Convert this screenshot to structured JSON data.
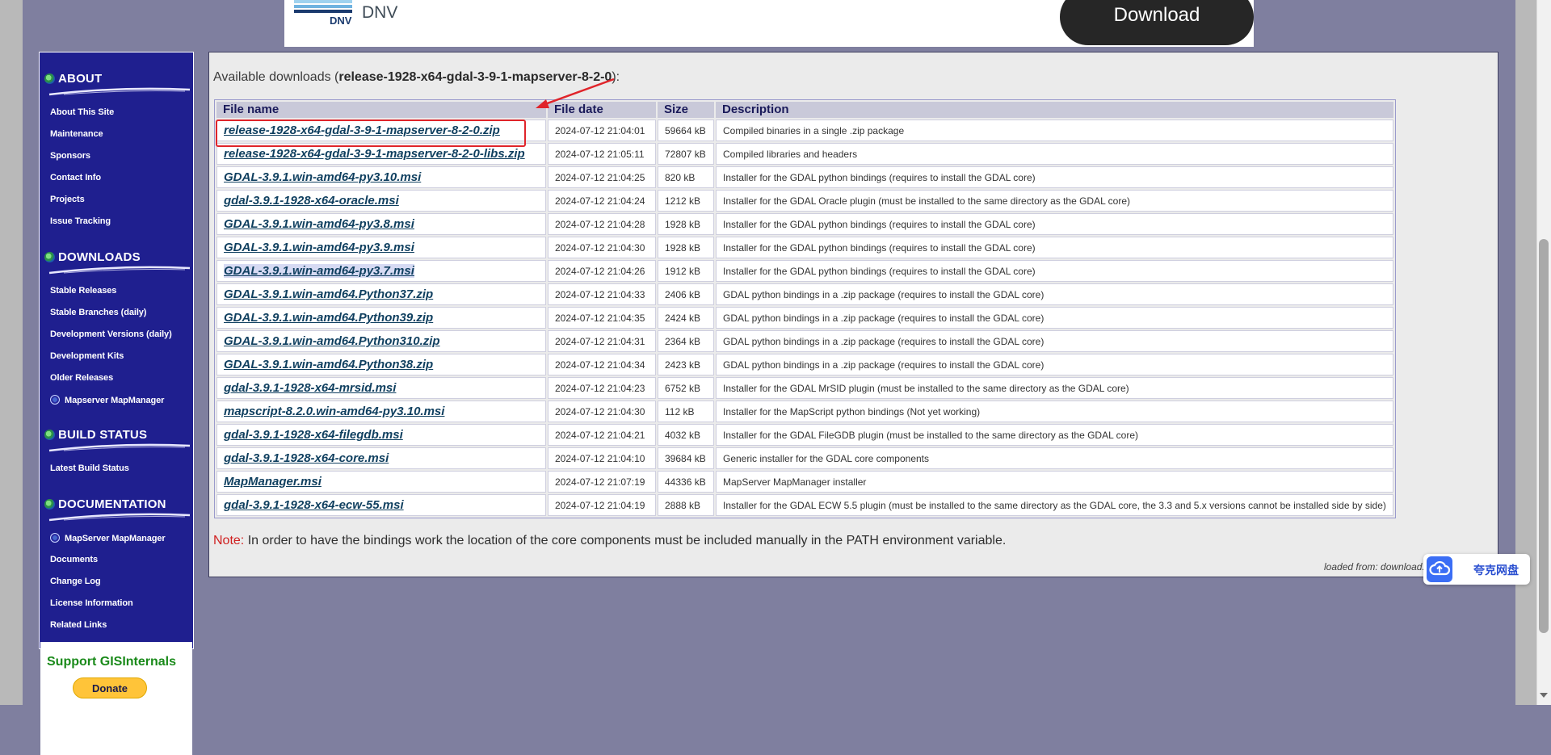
{
  "ad": {
    "brand": "DNV",
    "logo_text": "DNV",
    "button_label": "Download"
  },
  "sidebar": {
    "sections": [
      {
        "title": "ABOUT",
        "links": [
          "About This Site",
          "Maintenance",
          "Sponsors",
          "Contact Info",
          "Projects",
          "Issue Tracking"
        ]
      },
      {
        "title": "DOWNLOADS",
        "links": [
          "Stable Releases",
          "Stable Branches (daily)",
          "Development Versions (daily)",
          "Development Kits",
          "Older Releases",
          "Mapserver MapManager"
        ]
      },
      {
        "title": "BUILD STATUS",
        "links": [
          "Latest Build Status"
        ]
      },
      {
        "title": "DOCUMENTATION",
        "links": [
          "MapServer MapManager",
          "Documents",
          "Change Log",
          "License Information",
          "Related Links"
        ]
      }
    ],
    "support_title": "Support GISInternals",
    "donate_label": "Donate"
  },
  "main": {
    "avail_prefix": "Available downloads (",
    "release_name": "release-1928-x64-gdal-3-9-1-mapserver-8-2-0",
    "avail_suffix": "):",
    "columns": [
      "File name",
      "File date",
      "Size",
      "Description"
    ],
    "rows": [
      {
        "name": "release-1928-x64-gdal-3-9-1-mapserver-8-2-0.zip",
        "date": "2024-07-12 21:04:01",
        "size": "59664 kB",
        "desc": "Compiled binaries in a single .zip package"
      },
      {
        "name": "release-1928-x64-gdal-3-9-1-mapserver-8-2-0-libs.zip",
        "date": "2024-07-12 21:05:11",
        "size": "72807 kB",
        "desc": "Compiled libraries and headers"
      },
      {
        "name": "GDAL-3.9.1.win-amd64-py3.10.msi",
        "date": "2024-07-12 21:04:25",
        "size": "820 kB",
        "desc": "Installer for the GDAL python bindings (requires to install the GDAL core)"
      },
      {
        "name": "gdal-3.9.1-1928-x64-oracle.msi",
        "date": "2024-07-12 21:04:24",
        "size": "1212 kB",
        "desc": "Installer for the GDAL Oracle plugin (must be installed to the same directory as the GDAL core)"
      },
      {
        "name": "GDAL-3.9.1.win-amd64-py3.8.msi",
        "date": "2024-07-12 21:04:28",
        "size": "1928 kB",
        "desc": "Installer for the GDAL python bindings (requires to install the GDAL core)"
      },
      {
        "name": "GDAL-3.9.1.win-amd64-py3.9.msi",
        "date": "2024-07-12 21:04:30",
        "size": "1928 kB",
        "desc": "Installer for the GDAL python bindings (requires to install the GDAL core)"
      },
      {
        "name": "GDAL-3.9.1.win-amd64-py3.7.msi",
        "date": "2024-07-12 21:04:26",
        "size": "1912 kB",
        "desc": "Installer for the GDAL python bindings (requires to install the GDAL core)"
      },
      {
        "name": "GDAL-3.9.1.win-amd64.Python37.zip",
        "date": "2024-07-12 21:04:33",
        "size": "2406 kB",
        "desc": "GDAL python bindings in a .zip package (requires to install the GDAL core)"
      },
      {
        "name": "GDAL-3.9.1.win-amd64.Python39.zip",
        "date": "2024-07-12 21:04:35",
        "size": "2424 kB",
        "desc": "GDAL python bindings in a .zip package (requires to install the GDAL core)"
      },
      {
        "name": "GDAL-3.9.1.win-amd64.Python310.zip",
        "date": "2024-07-12 21:04:31",
        "size": "2364 kB",
        "desc": "GDAL python bindings in a .zip package (requires to install the GDAL core)"
      },
      {
        "name": "GDAL-3.9.1.win-amd64.Python38.zip",
        "date": "2024-07-12 21:04:34",
        "size": "2423 kB",
        "desc": "GDAL python bindings in a .zip package (requires to install the GDAL core)"
      },
      {
        "name": "gdal-3.9.1-1928-x64-mrsid.msi",
        "date": "2024-07-12 21:04:23",
        "size": "6752 kB",
        "desc": "Installer for the GDAL MrSID plugin (must be installed to the same directory as the GDAL core)"
      },
      {
        "name": "mapscript-8.2.0.win-amd64-py3.10.msi",
        "date": "2024-07-12 21:04:30",
        "size": "112 kB",
        "desc": "Installer for the MapScript python bindings (Not yet working)"
      },
      {
        "name": "gdal-3.9.1-1928-x64-filegdb.msi",
        "date": "2024-07-12 21:04:21",
        "size": "4032 kB",
        "desc": "Installer for the GDAL FileGDB plugin (must be installed to the same directory as the GDAL core)"
      },
      {
        "name": "gdal-3.9.1-1928-x64-core.msi",
        "date": "2024-07-12 21:04:10",
        "size": "39684 kB",
        "desc": "Generic installer for the GDAL core components"
      },
      {
        "name": "MapManager.msi",
        "date": "2024-07-12 21:07:19",
        "size": "44336 kB",
        "desc": "MapServer MapManager installer"
      },
      {
        "name": "gdal-3.9.1-1928-x64-ecw-55.msi",
        "date": "2024-07-12 21:04:19",
        "size": "2888 kB",
        "desc": "Installer for the GDAL ECW 5.5 plugin (must be installed to the same directory as the GDAL core, the 3.3 and 5.x versions cannot be installed side by side)"
      }
    ],
    "note_label": "Note:",
    "note_text": " In order to have the bindings work the location of the core components must be included manually in the PATH environment variable.",
    "loaded_from": "loaded from: download.g"
  },
  "cloud_widget": {
    "label": "夸克网盘"
  },
  "colors": {
    "highlight": "#e0242a",
    "sidebar_bg": "#1f1f8f",
    "page_bg": "#7f7f9f"
  }
}
